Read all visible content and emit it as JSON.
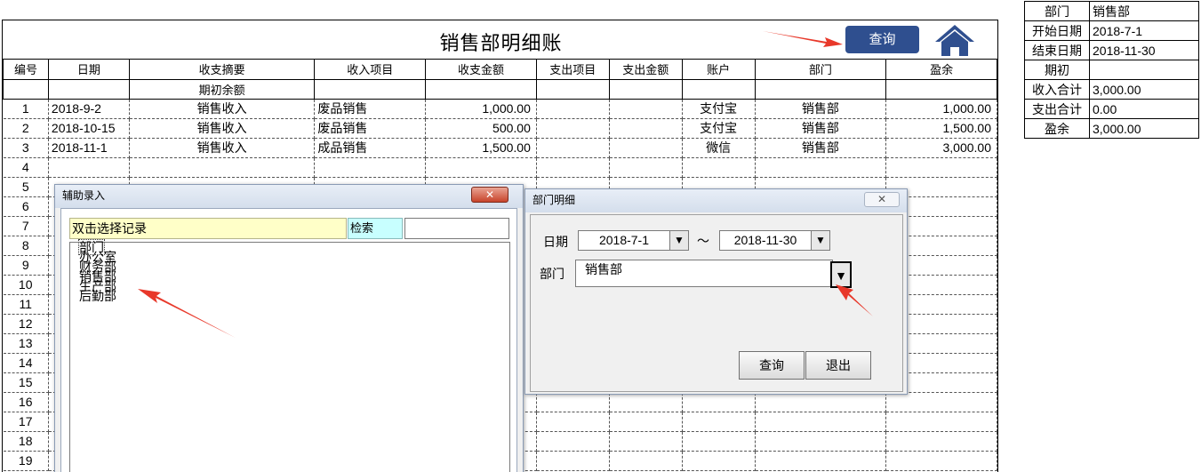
{
  "ledger": {
    "title": "销售部明细账",
    "query_button": "查询",
    "headers": [
      "编号",
      "日期",
      "收支摘要",
      "收入项目",
      "收支金额",
      "支出项目",
      "支出金额",
      "账户",
      "部门",
      "盈余"
    ],
    "opening_label": "期初余额",
    "rows": [
      [
        "1",
        "2018-9-2",
        "销售收入",
        "废品销售",
        "1,000.00",
        "",
        "",
        "支付宝",
        "销售部",
        "1,000.00"
      ],
      [
        "2",
        "2018-10-15",
        "销售收入",
        "废品销售",
        "500.00",
        "",
        "",
        "支付宝",
        "销售部",
        "1,500.00"
      ],
      [
        "3",
        "2018-11-1",
        "销售收入",
        "成品销售",
        "1,500.00",
        "",
        "",
        "微信",
        "销售部",
        "3,000.00"
      ],
      [
        "4",
        "",
        "",
        "",
        "",
        "",
        "",
        "",
        "",
        ""
      ],
      [
        "5",
        "",
        "",
        "",
        "",
        "",
        "",
        "",
        "",
        ""
      ],
      [
        "6",
        "",
        "",
        "",
        "",
        "",
        "",
        "",
        "",
        ""
      ],
      [
        "7",
        "",
        "",
        "",
        "",
        "",
        "",
        "",
        "",
        ""
      ],
      [
        "8",
        "",
        "",
        "",
        "",
        "",
        "",
        "",
        "",
        ""
      ],
      [
        "9",
        "",
        "",
        "",
        "",
        "",
        "",
        "",
        "",
        ""
      ],
      [
        "10",
        "",
        "",
        "",
        "",
        "",
        "",
        "",
        "",
        ""
      ],
      [
        "11",
        "",
        "",
        "",
        "",
        "",
        "",
        "",
        "",
        ""
      ],
      [
        "12",
        "",
        "",
        "",
        "",
        "",
        "",
        "",
        "",
        ""
      ],
      [
        "13",
        "",
        "",
        "",
        "",
        "",
        "",
        "",
        "",
        ""
      ],
      [
        "14",
        "",
        "",
        "",
        "",
        "",
        "",
        "",
        "",
        ""
      ],
      [
        "15",
        "",
        "",
        "",
        "",
        "",
        "",
        "",
        "",
        ""
      ],
      [
        "16",
        "",
        "",
        "",
        "",
        "",
        "",
        "",
        "",
        ""
      ],
      [
        "17",
        "",
        "",
        "",
        "",
        "",
        "",
        "",
        "",
        ""
      ],
      [
        "18",
        "",
        "",
        "",
        "",
        "",
        "",
        "",
        "",
        ""
      ],
      [
        "19",
        "",
        "",
        "",
        "",
        "",
        "",
        "",
        "",
        ""
      ]
    ]
  },
  "summary": [
    {
      "label": "部门",
      "value": "销售部"
    },
    {
      "label": "开始日期",
      "value": "2018-7-1"
    },
    {
      "label": "结束日期",
      "value": "2018-11-30"
    },
    {
      "label": "期初",
      "value": ""
    },
    {
      "label": "收入合计",
      "value": "3,000.00"
    },
    {
      "label": "支出合计",
      "value": "0.00"
    },
    {
      "label": "盈余",
      "value": "3,000.00"
    }
  ],
  "assist_dialog": {
    "title": "辅助录入",
    "close": "✕",
    "hint": "双击选择记录",
    "search_label": "检索",
    "search_value": "",
    "items": [
      "部门",
      "办公室",
      "财务部",
      "销售部",
      "生产部",
      "后勤部"
    ]
  },
  "dept_dialog": {
    "title": "部门明细",
    "close": "✕",
    "date_label": "日期",
    "start_date": "2018-7-1",
    "tilde": "～",
    "end_date": "2018-11-30",
    "dept_label": "部门",
    "dept_value": "销售部",
    "query": "查询",
    "exit": "退出"
  },
  "colors": {
    "query_button_bg": "#2f4f8f",
    "home_icon": "#2f4f8f",
    "annotation_arrow": "#e8382a",
    "hint_bg": "#ffffc8",
    "search_label_bg": "#c8ffff"
  },
  "icons": {
    "home": "home-icon",
    "dropdown": "triangle-down-icon",
    "annotation": "red-arrow-icon"
  }
}
